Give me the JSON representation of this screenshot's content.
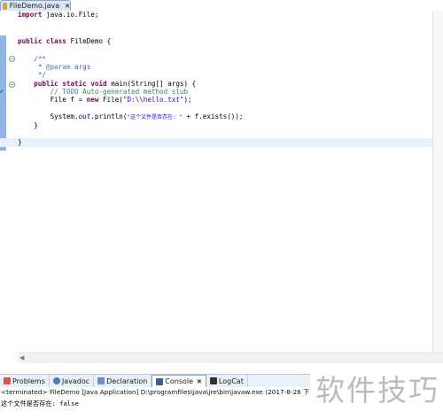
{
  "editor_tab": {
    "label": "FileDemo.java",
    "close": "✖"
  },
  "code": {
    "l1_kw": "import",
    "l1_rest": " java.io.File;",
    "l2_kw1": "public",
    "l2_kw2": "class",
    "l2_rest": " FileDemo {",
    "l3": "    /**",
    "l4_pre": "     * ",
    "l4_tag": "@param",
    "l4_rest": " args",
    "l5": "     */",
    "l6_kw1": "public",
    "l6_kw2": "static",
    "l6_kw3": "void",
    "l6_rest": " main(String[] args) {",
    "l7_pre": "        // ",
    "l7_todo": "TODO",
    "l7_rest": " Auto-generated method stub",
    "l8_a": "        File f = ",
    "l8_kw": "new",
    "l8_b": " File(",
    "l8_str": "\"D:\\\\hello.txt\"",
    "l8_c": ");",
    "l9_a": "        System.",
    "l9_fld": "out",
    "l9_b": ".println(",
    "l9_str": "\"这个文件是否存在: \"",
    "l9_c": " + f.exists());",
    "l10": "    }",
    "l11": "}"
  },
  "view_tabs": [
    {
      "label": "Problems"
    },
    {
      "label": "Javadoc"
    },
    {
      "label": "Declaration"
    },
    {
      "label": "Console",
      "close": "✖"
    },
    {
      "label": "LogCat"
    }
  ],
  "console": {
    "header": "<terminated> FileDemo [Java Application] D:\\programfiles\\java\\jre\\bin\\javaw.exe (2017-8-26 下",
    "output": "这个文件是否存在: false"
  },
  "watermark": "软件技巧",
  "colors": {
    "keyword": "#7f0055",
    "comment": "#3f5fbf",
    "string": "#2a00ff",
    "current_line": "#e8f2fe",
    "change_band": "#8fb6e6"
  }
}
